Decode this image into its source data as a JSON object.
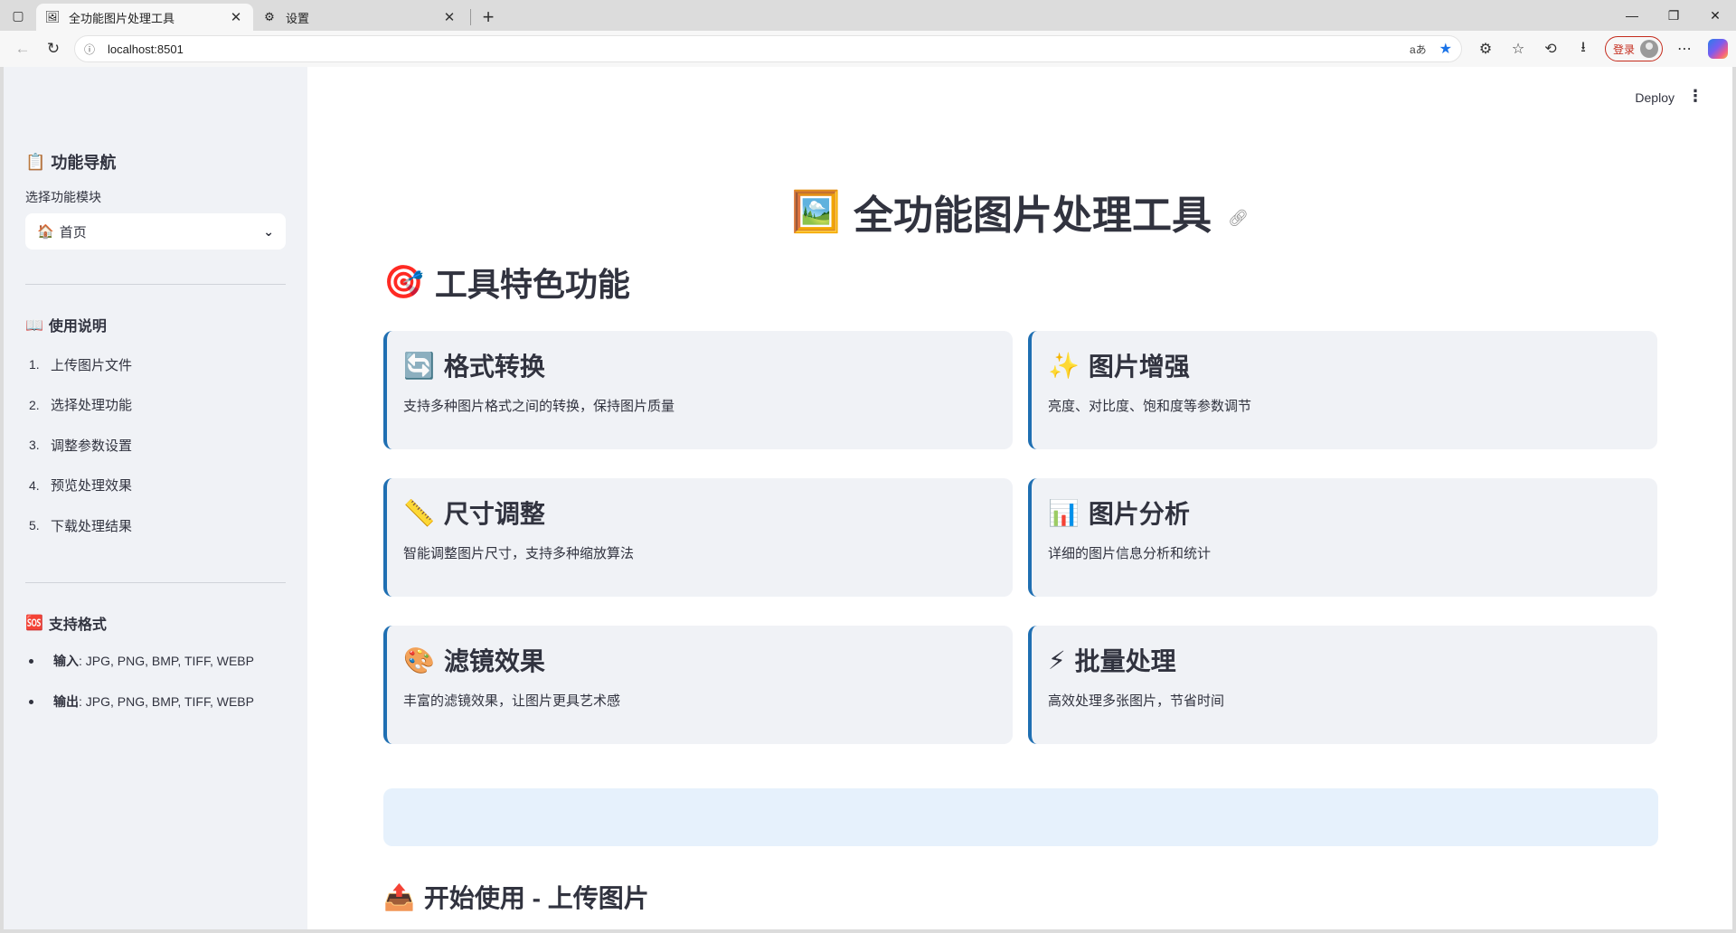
{
  "browser": {
    "tabs": [
      {
        "title": "全功能图片处理工具",
        "favicon": "picture-favicon",
        "active": true
      },
      {
        "title": "设置",
        "favicon": "gear-icon",
        "active": false
      }
    ],
    "url": "localhost:8501",
    "read_aloud": "aあ",
    "login_label": "登录",
    "window_controls": {
      "minimize": "—",
      "restore": "❐",
      "close": "✕"
    }
  },
  "sidebar": {
    "nav_title": "功能导航",
    "nav_icon": "📋",
    "select_label": "选择功能模块",
    "select_value": "首页",
    "select_icon": "🏠",
    "usage_title": "使用说明",
    "usage_icon": "📖",
    "steps": [
      {
        "num": "1.",
        "text": "上传图片文件"
      },
      {
        "num": "2.",
        "text": "选择处理功能"
      },
      {
        "num": "3.",
        "text": "调整参数设置"
      },
      {
        "num": "4.",
        "text": "预览处理效果"
      },
      {
        "num": "5.",
        "text": "下载处理结果"
      }
    ],
    "formats_title": "支持格式",
    "formats_icon": "🆘",
    "formats": [
      {
        "label": "输入",
        "value": ": JPG, PNG, BMP, TIFF, WEBP"
      },
      {
        "label": "输出",
        "value": ": JPG, PNG, BMP, TIFF, WEBP"
      }
    ]
  },
  "header": {
    "deploy": "Deploy",
    "menu_icon": "⋮"
  },
  "main": {
    "title": "全功能图片处理工具",
    "title_icon": "🖼️",
    "features_title": "工具特色功能",
    "features_icon": "🎯",
    "cards": [
      {
        "icon": "🔄",
        "title": "格式转换",
        "desc": "支持多种图片格式之间的转换，保持图片质量"
      },
      {
        "icon": "✨",
        "title": "图片增强",
        "desc": "亮度、对比度、饱和度等参数调节"
      },
      {
        "icon": "📏",
        "title": "尺寸调整",
        "desc": "智能调整图片尺寸，支持多种缩放算法"
      },
      {
        "icon": "📊",
        "title": "图片分析",
        "desc": "详细的图片信息分析和统计"
      },
      {
        "icon": "🎨",
        "title": "滤镜效果",
        "desc": "丰富的滤镜效果，让图片更具艺术感"
      },
      {
        "icon": "⚡",
        "title": "批量处理",
        "desc": "高效处理多张图片，节省时间"
      }
    ],
    "upload_title": "开始使用 - 上传图片",
    "upload_icon": "📤"
  },
  "colors": {
    "accent": "#1f6fb2",
    "sidebar_bg": "#f0f2f6",
    "info_bg": "#e6f1fc",
    "login": "#c42b1c"
  }
}
